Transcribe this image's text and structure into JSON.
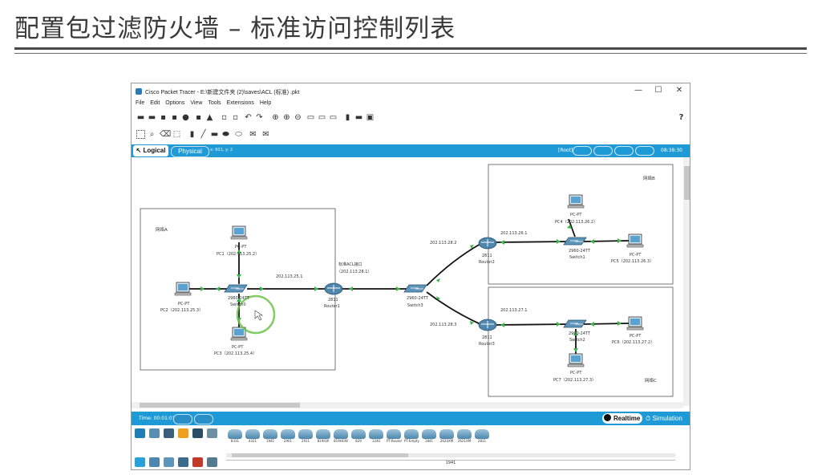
{
  "slide": {
    "title": "配置包过滤防火墙 – 标准访问控制列表"
  },
  "window": {
    "title": "Cisco Packet Tracer - E:\\新建文件夹 (2)\\saves\\ACL (标准) .pkt",
    "controls": {
      "minimize": "—",
      "maximize": "☐",
      "close": "✕"
    }
  },
  "menu": [
    "File",
    "Edit",
    "Options",
    "View",
    "Tools",
    "Extensions",
    "Help"
  ],
  "help_glyph": "?",
  "tabs": {
    "logical": "Logical",
    "physical": "Physical",
    "coords": "x: 601, y: 2",
    "root": "[Root]",
    "clock": "08:38:30"
  },
  "topology": {
    "areas": [
      {
        "id": "area-a",
        "label": "网络A"
      },
      {
        "id": "area-b",
        "label": "网络B"
      },
      {
        "id": "area-c",
        "label": "网络C"
      }
    ],
    "nodes": {
      "router1": {
        "model": "2811",
        "name": "Router1"
      },
      "router2": {
        "model": "2811",
        "name": "Router2"
      },
      "router3": {
        "model": "2811",
        "name": "Router3"
      },
      "switch0": {
        "model": "2960-24TT",
        "name": "Switch0"
      },
      "switch1": {
        "model": "2960-24TT",
        "name": "Switch1"
      },
      "switch2": {
        "model": "2960-24TT",
        "name": "Switch2"
      },
      "switch3": {
        "model": "2960-24TT",
        "name": "Switch3"
      },
      "pc1": {
        "type": "PC-PT",
        "label": "PC1（202.113.25.2）"
      },
      "pc2": {
        "type": "PC-PT",
        "label": "PC2（202.113.25.3）"
      },
      "pc3": {
        "type": "PC-PT",
        "label": "PC3（202.113.25.4）"
      },
      "pc4": {
        "type": "PC-PT",
        "label": "PC4（202.113.26.2）"
      },
      "pc5": {
        "type": "PC-PT",
        "label": "PC5（202.113.26.3）"
      },
      "pc6": {
        "type": "PC-PT",
        "label": "PC6（202.113.27.2）"
      },
      "pc7": {
        "type": "PC-PT",
        "label": "PC7（202.113.27.3）"
      }
    },
    "ips": {
      "r1_a": "202.113.25.1",
      "r2_sw3": "202.113.28.2",
      "r3_sw3": "202.113.28.3",
      "r2_b": "202.113.26.1",
      "r3_c": "202.113.27.1"
    },
    "acl_note": [
      "标准ACL接口",
      "（202.113.28.1）"
    ]
  },
  "status": {
    "time": "Time: 00:01:01",
    "realtime": "Realtime",
    "simulation": "Simulation"
  },
  "device_list": [
    "8331",
    "4321",
    "1941",
    "2901",
    "2911",
    "819IOX",
    "819HGW",
    "829",
    "1240",
    "PT-Router",
    "PT-Empty",
    "1841",
    "2620XM",
    "2621XM",
    "2811"
  ],
  "device_selected": "1941",
  "colors": {
    "accent": "#1e9ad6",
    "link": "#111111",
    "port_up": "#39b54a",
    "cursor_ring": "#6cc24a"
  }
}
